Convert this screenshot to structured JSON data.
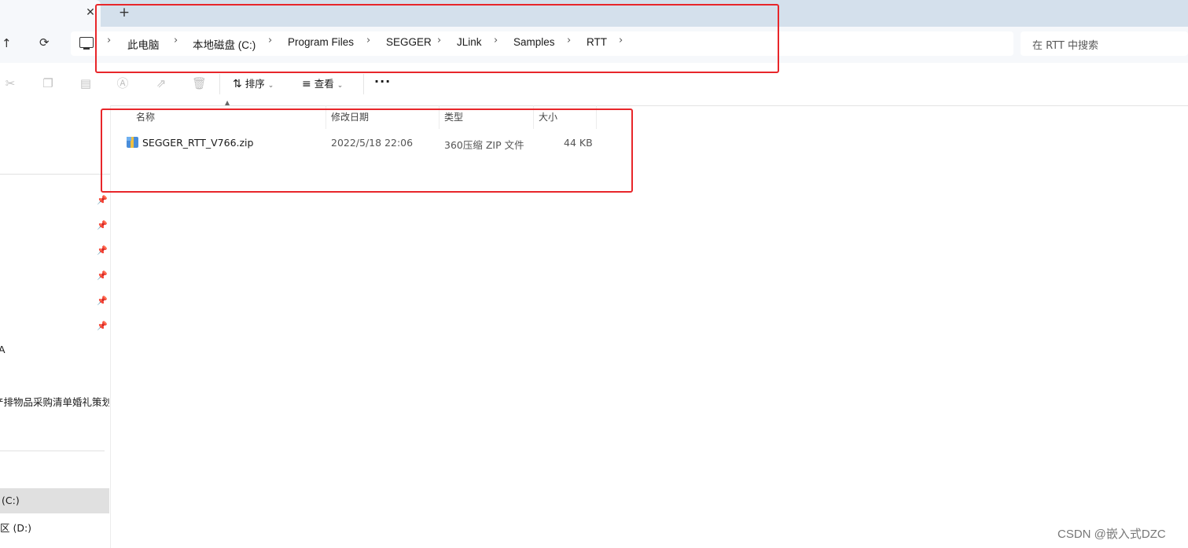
{
  "tabs": {
    "close_glyph": "✕",
    "new_glyph": "+"
  },
  "nav": {
    "up_glyph": "↑",
    "refresh_glyph": "⟳",
    "breadcrumbs": [
      "此电脑",
      "本地磁盘 (C:)",
      "Program Files",
      "SEGGER",
      "JLink",
      "Samples",
      "RTT"
    ],
    "separator": "›",
    "search_placeholder": "在 RTT 中搜索"
  },
  "toolbar": {
    "sort_label": "排序",
    "view_label": "查看",
    "more_label": "···",
    "icons": [
      "cut-icon",
      "copy-icon",
      "paste-icon",
      "rename-icon",
      "share-icon",
      "delete-icon"
    ]
  },
  "sidebar": {
    "items_visible": [
      "A",
      "产排物品采购清单婚礼策划",
      "(C:)",
      "区 (D:)"
    ],
    "selected": "(C:)"
  },
  "file_list": {
    "columns": [
      "名称",
      "修改日期",
      "类型",
      "大小"
    ],
    "rows": [
      {
        "name": "SEGGER_RTT_V766.zip",
        "modified": "2022/5/18 22:06",
        "type": "360压缩 ZIP 文件",
        "size": "44 KB"
      }
    ]
  },
  "watermark": "CSDN @嵌入式DZC",
  "colors": {
    "annotation": "#e8262a",
    "tabbar": "#d4e0ec",
    "navbar": "#f6f8fb"
  }
}
